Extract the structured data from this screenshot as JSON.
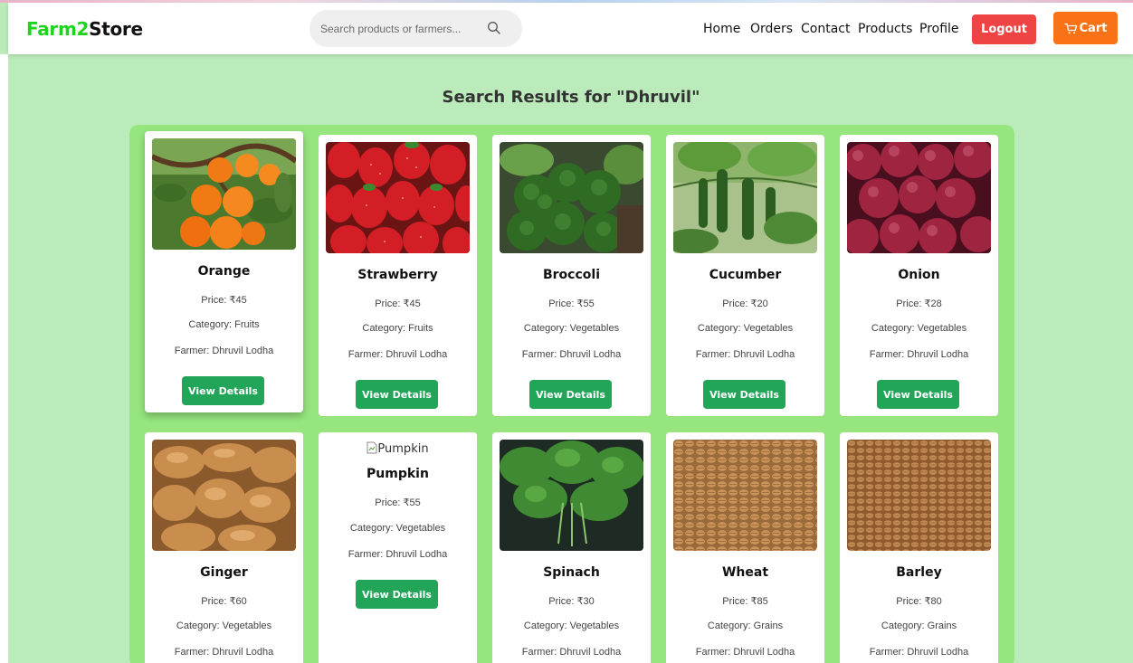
{
  "header": {
    "brand_part1": "Farm2",
    "brand_part2": "Store",
    "search_placeholder": "Search products or farmers...",
    "nav": [
      "Home",
      "Orders",
      "Contact",
      "Products",
      "Profile"
    ],
    "logout_label": "Logout",
    "cart_label": "Cart"
  },
  "page": {
    "title": "Search Results for \"Dhruvil\""
  },
  "button_label": "View Details",
  "products": [
    {
      "name": "Orange",
      "price": "Price: ₹45",
      "category": "Category: Fruits",
      "farmer": "Farmer: Dhruvil Lodha"
    },
    {
      "name": "Strawberry",
      "price": "Price: ₹45",
      "category": "Category: Fruits",
      "farmer": "Farmer: Dhruvil Lodha"
    },
    {
      "name": "Broccoli",
      "price": "Price: ₹55",
      "category": "Category: Vegetables",
      "farmer": "Farmer: Dhruvil Lodha"
    },
    {
      "name": "Cucumber",
      "price": "Price: ₹20",
      "category": "Category: Vegetables",
      "farmer": "Farmer: Dhruvil Lodha"
    },
    {
      "name": "Onion",
      "price": "Price: ₹28",
      "category": "Category: Vegetables",
      "farmer": "Farmer: Dhruvil Lodha"
    },
    {
      "name": "Ginger",
      "price": "Price: ₹60",
      "category": "Category: Vegetables",
      "farmer": "Farmer: Dhruvil Lodha"
    },
    {
      "name": "Pumpkin",
      "price": "Price: ₹55",
      "category": "Category: Vegetables",
      "farmer": "Farmer: Dhruvil Lodha",
      "broken_image_alt": "Pumpkin"
    },
    {
      "name": "Spinach",
      "price": "Price: ₹30",
      "category": "Category: Vegetables",
      "farmer": "Farmer: Dhruvil Lodha"
    },
    {
      "name": "Wheat",
      "price": "Price: ₹85",
      "category": "Category: Grains",
      "farmer": "Farmer: Dhruvil Lodha"
    },
    {
      "name": "Barley",
      "price": "Price: ₹80",
      "category": "Category: Grains",
      "farmer": "Farmer: Dhruvil Lodha"
    }
  ],
  "colors": {
    "brand_green": "#1fd41f",
    "page_bg": "#bbebbb",
    "results_bg": "#96e57e",
    "logout_red": "#ef4444",
    "cart_orange": "#f97316",
    "view_button_green": "#22a559"
  },
  "icons": {
    "search": "search-icon",
    "cart": "cart-icon",
    "broken_image": "broken-image-icon"
  }
}
